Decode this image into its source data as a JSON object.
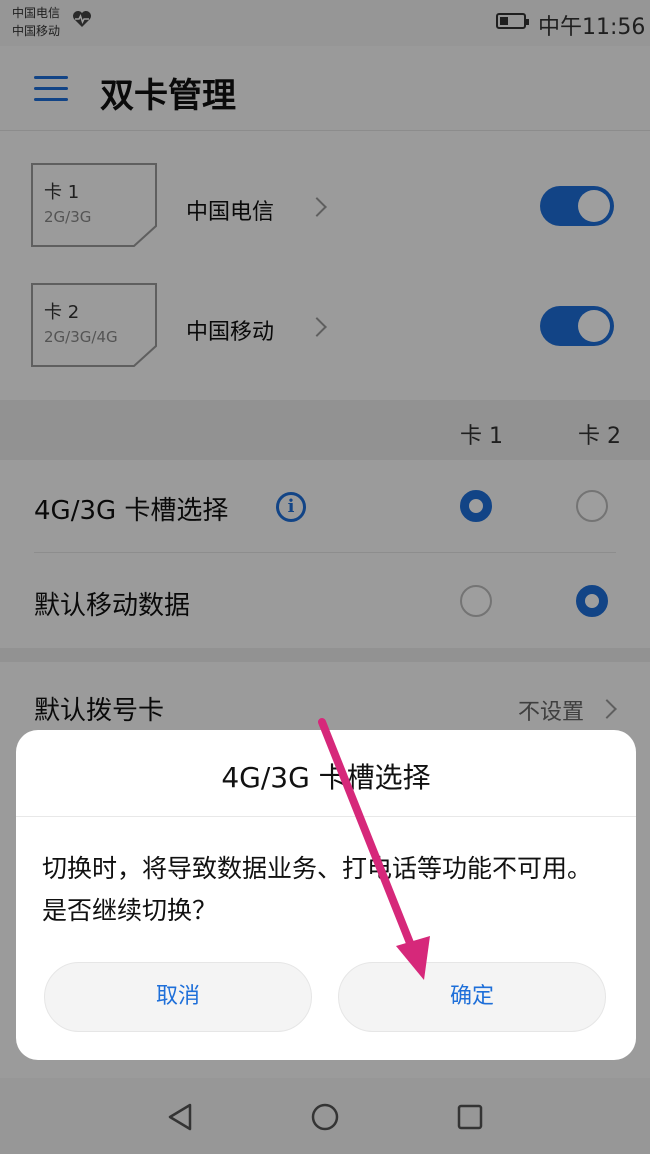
{
  "status_bar": {
    "carrier1": "中国电信",
    "carrier2": "中国移动",
    "time": "中午11:56"
  },
  "app_bar": {
    "title": "双卡管理",
    "menu_icon": "hamburger-menu-icon"
  },
  "sims": [
    {
      "card": "卡 1",
      "tech": "2G/3G",
      "carrier": "中国电信",
      "enabled": true
    },
    {
      "card": "卡 2",
      "tech": "2G/3G/4G",
      "carrier": "中国移动",
      "enabled": true
    }
  ],
  "columns": {
    "col1": "卡 1",
    "col2": "卡 2"
  },
  "options": [
    {
      "label": "4G/3G 卡槽选择",
      "selected": "卡 1",
      "info_icon": "info-icon"
    },
    {
      "label": "默认移动数据",
      "selected": "卡 2"
    }
  ],
  "default_dial": {
    "label": "默认拨号卡",
    "value": "不设置"
  },
  "dialog": {
    "title": "4G/3G 卡槽选择",
    "message": "切换时，将导致数据业务、打电话等功能不可用。是否继续切换？",
    "cancel_label": "取消",
    "confirm_label": "确定"
  },
  "colors": {
    "accent": "#1e6fd9",
    "arrow": "#d6287a"
  }
}
